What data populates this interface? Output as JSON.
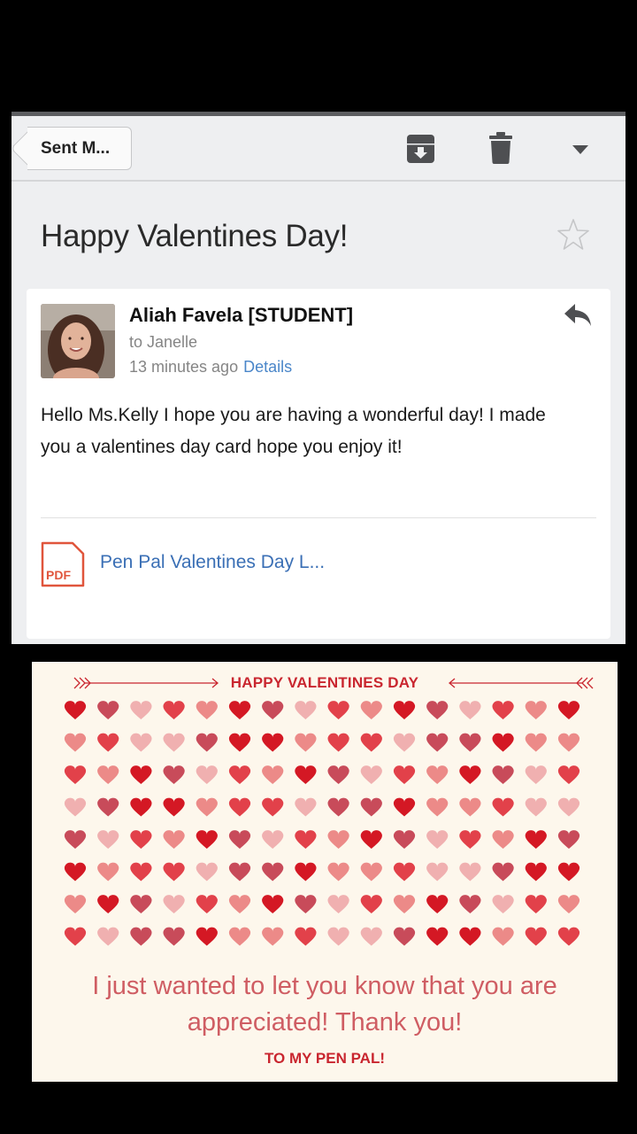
{
  "toolbar": {
    "back_label": "Sent M...",
    "icons": [
      "archive-icon",
      "trash-icon",
      "chevron-down-icon"
    ]
  },
  "email": {
    "subject": "Happy Valentines Day!",
    "sender": "Aliah Favela [STUDENT]",
    "recipient": "to Janelle",
    "time": "13 minutes ago",
    "details_label": "Details",
    "body": "Hello Ms.Kelly I hope you are having a wonderful day! I made you a valentines day card hope you enjoy it!",
    "attachment": {
      "type_label": "PDF",
      "name": "Pen Pal Valentines Day L..."
    }
  },
  "card": {
    "title": "HAPPY VALENTINES DAY",
    "message_line1": "I just wanted to let you know that you are",
    "message_line2": "appreciated! Thank you!",
    "signature": "TO MY PEN PAL!",
    "colors": {
      "dark_red": "#d41824",
      "red": "#e2414a",
      "rose": "#c84b5a",
      "salmon": "#ec8a88",
      "pink": "#f0b0b0"
    }
  }
}
